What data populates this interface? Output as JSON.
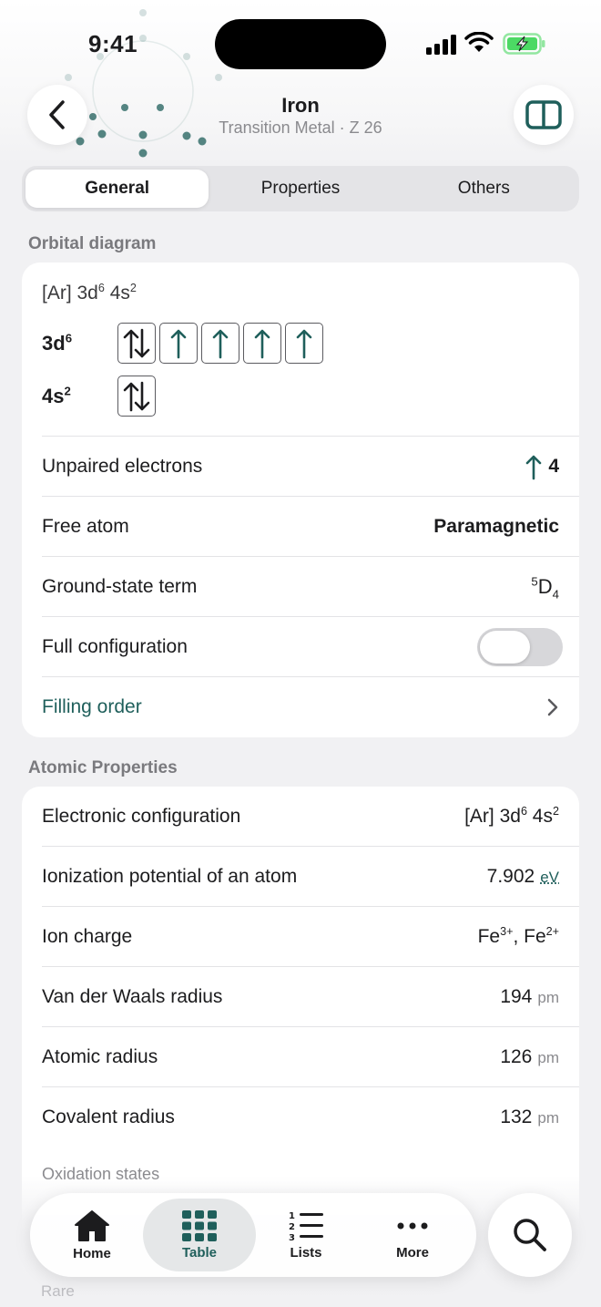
{
  "status": {
    "time": "9:41"
  },
  "header": {
    "title": "Iron",
    "subtitle": "Transition Metal · Z 26"
  },
  "tabs": [
    {
      "label": "General",
      "active": true
    },
    {
      "label": "Properties",
      "active": false
    },
    {
      "label": "Others",
      "active": false
    }
  ],
  "orbital": {
    "section_title": "Orbital diagram",
    "config_base": "[Ar] 3d",
    "config_sup1": "6",
    "config_mid": " 4s",
    "config_sup2": "2",
    "rows": [
      {
        "label": "3d",
        "sup": "6",
        "boxes": [
          "up-down",
          "up",
          "up",
          "up",
          "up"
        ]
      },
      {
        "label": "4s",
        "sup": "2",
        "boxes": [
          "up-down"
        ]
      }
    ],
    "unpaired_label": "Unpaired electrons",
    "unpaired_value": "4",
    "free_atom_label": "Free atom",
    "free_atom_value": "Paramagnetic",
    "term_label": "Ground-state term",
    "term_sup": "5",
    "term_letter": "D",
    "term_sub": "4",
    "full_config_label": "Full configuration",
    "full_config_on": false,
    "filling_order_label": "Filling order"
  },
  "atomic": {
    "section_title": "Atomic Properties",
    "electronic_config_label": "Electronic configuration",
    "ec_base": "[Ar] 3d",
    "ec_sup1": "6",
    "ec_mid": " 4s",
    "ec_sup2": "2",
    "ionization_label": "Ionization potential of an atom",
    "ionization_value": "7.902",
    "ionization_unit": "eV",
    "ion_charge_label": "Ion charge",
    "ion1": "Fe",
    "ion1_sup": "3+",
    "ion_sep": ", Fe",
    "ion2_sup": "2+",
    "vdw_label": "Van der Waals radius",
    "vdw_value": "194",
    "vdw_unit": "pm",
    "atomic_radius_label": "Atomic radius",
    "atomic_radius_value": "126",
    "atomic_radius_unit": "pm",
    "covalent_label": "Covalent radius",
    "covalent_value": "132",
    "covalent_unit": "pm",
    "oxidation_label": "Oxidation states",
    "rare_label": "Rare"
  },
  "tabbar": [
    {
      "label": "Home",
      "icon": "house-icon",
      "active": false
    },
    {
      "label": "Table",
      "icon": "grid-icon",
      "active": true
    },
    {
      "label": "Lists",
      "icon": "numbered-list-icon",
      "active": false
    },
    {
      "label": "More",
      "icon": "ellipsis-icon",
      "active": false
    }
  ],
  "colors": {
    "accent": "#1f5f5b",
    "background": "#f1f1f3",
    "battery": "#4cd964"
  }
}
